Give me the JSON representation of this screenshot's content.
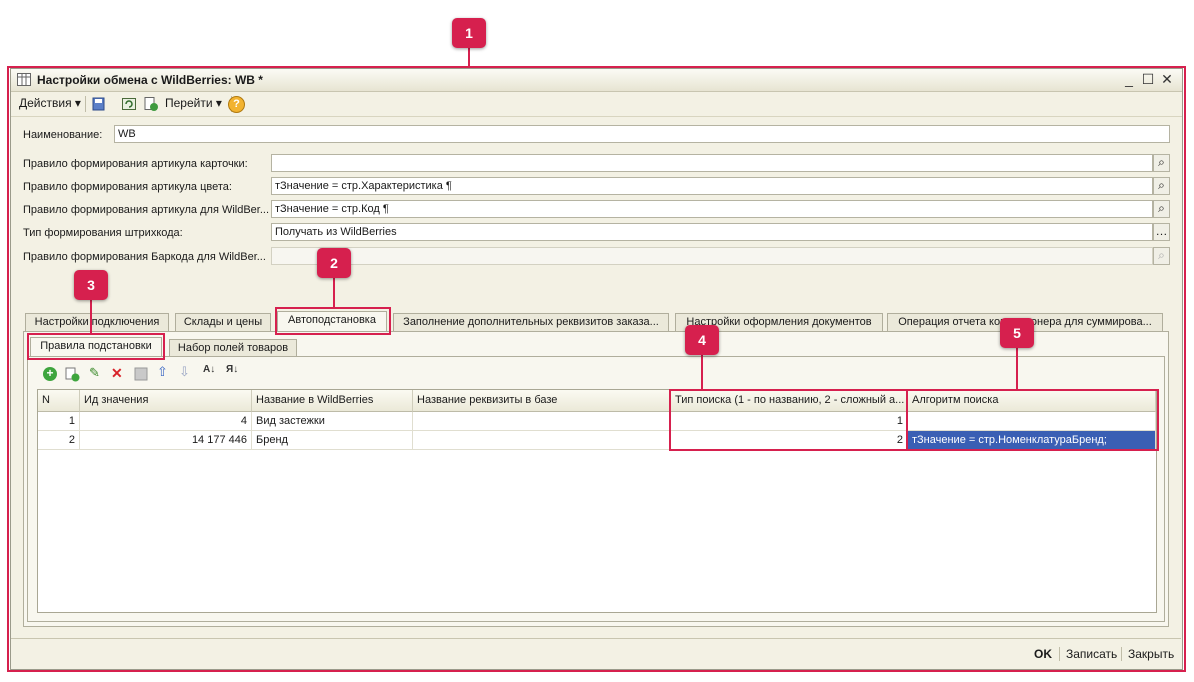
{
  "window": {
    "title": "Настройки обмена с WildBerries: WB *",
    "controls": {
      "minimize": "_",
      "maximize": "☐",
      "close": "✕"
    }
  },
  "toolbar": {
    "actions_label": "Действия",
    "goto_label": "Перейти",
    "help_label": "?"
  },
  "form": {
    "name_label": "Наименование:",
    "name_value": "WB",
    "rows": [
      {
        "label": "Правило формирования артикула карточки:",
        "value": "",
        "button": "search-icon"
      },
      {
        "label": "Правило формирования артикула цвета:",
        "value": "тЗначение =  стр.Характеристика ¶",
        "button": "search-icon"
      },
      {
        "label": "Правило формирования артикула для WildBer...",
        "value": "тЗначение =  стр.Код  ¶",
        "button": "search-icon"
      },
      {
        "label": "Тип формирования штрихкода:",
        "value": "Получать из WildBerries",
        "button": "ellipsis-icon"
      },
      {
        "label": "Правило формирования Баркода  для WildBer...",
        "value": "",
        "button": "search-icon"
      }
    ]
  },
  "tabs": [
    "Настройки подключения",
    "Склады и цены",
    "Автоподстановка",
    "Заполнение дополнительных реквизитов заказа...",
    "Настройки оформления документов",
    "Операция отчета комиссионера для суммирова..."
  ],
  "subtabs": [
    "Правила подстановки",
    "Набор полей товаров"
  ],
  "table": {
    "columns": [
      "N",
      "Ид значения",
      "Название в WildBerries",
      "Название реквизиты в базе",
      "Тип поиска (1 - по названию, 2 - сложный а...",
      "Алгоритм поиска"
    ],
    "rows": [
      [
        "1",
        "4",
        "Вид застежки",
        "",
        "1",
        ""
      ],
      [
        "2",
        "14 177 446",
        "Бренд",
        "",
        "2",
        "тЗначение =  стр.НоменклатураБренд;"
      ]
    ]
  },
  "footer": {
    "ok": "OK",
    "save": "Записать",
    "close": "Закрыть"
  },
  "callouts": [
    "1",
    "2",
    "3",
    "4",
    "5"
  ],
  "colors": {
    "callout": "#d6204e",
    "selection": "#3a5fb4",
    "window_bg": "#f3f1e4"
  }
}
